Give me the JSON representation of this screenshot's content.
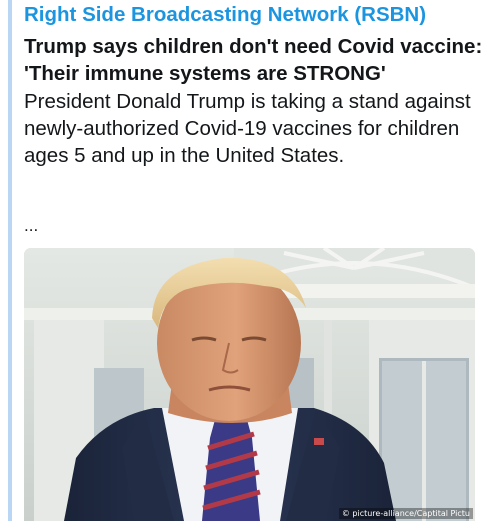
{
  "tweet_card": {
    "source": "Right Side Broadcasting Network (RSBN)",
    "headline_line1": "Trump says children don't need Covid vaccine:",
    "headline_line2": "'Their immune systems are STRONG'",
    "summary": "President Donald Trump is taking a stand against newly-authorized Covid-19 vaccines for children ages 5 and up in the United States.",
    "ellipsis": "...",
    "image": {
      "subject": "man-in-suit-photo",
      "credit": "© picture-alliance/Captital Pictu"
    }
  },
  "colors": {
    "source_link": "#1b95e0",
    "quote_bar": "#b9d7f4",
    "text": "#14171a"
  }
}
